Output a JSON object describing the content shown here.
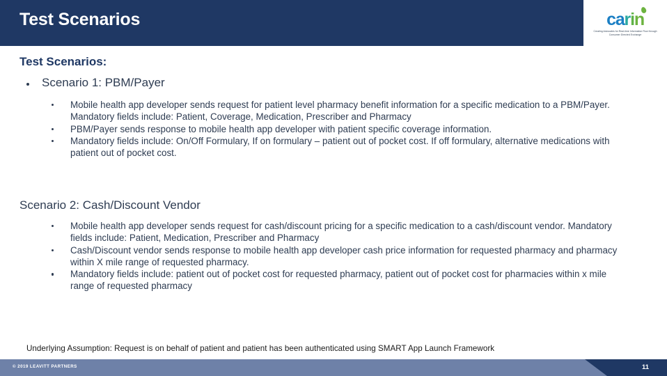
{
  "header": {
    "title": "Test Scenarios",
    "logo": {
      "wordmark": "carin",
      "letters": [
        "c",
        "a",
        "r",
        "i",
        "n"
      ],
      "tagline": "Creating Advocates for Real-time Information Flow through Consumer Directed Exchange",
      "colors": {
        "blue": "#1b7fc4",
        "teal": "#2aa9a0",
        "green": "#6cb33f"
      }
    },
    "background_color": "#1f3864"
  },
  "body": {
    "lead_label": "Test Scenarios:",
    "scenario1": {
      "heading": "Scenario 1: PBM/Payer",
      "bullets": [
        "Mobile health app developer sends request for patient level pharmacy benefit information for a specific medication to a PBM/Payer.  Mandatory fields include: Patient, Coverage, Medication, Prescriber and Pharmacy",
        "PBM/Payer sends response to mobile health app developer with patient specific coverage information.",
        "Mandatory fields include: On/Off Formulary, If on formulary – patient out of pocket cost.  If off formulary, alternative medications with patient out of pocket cost."
      ]
    },
    "scenario2": {
      "heading": "Scenario 2: Cash/Discount Vendor",
      "bullets": [
        "Mobile health app developer sends request for cash/discount pricing for a specific medication to a cash/discount vendor.  Mandatory fields include: Patient, Medication, Prescriber and Pharmacy",
        "Cash/Discount vendor sends response to mobile health app developer cash price information for requested pharmacy and pharmacy within X mile range of requested pharmacy.",
        "Mandatory fields include: patient out of pocket cost for requested pharmacy, patient out of pocket cost for pharmacies within x mile range of requested pharmacy"
      ]
    },
    "assumption": "Underlying Assumption: Request is on behalf of patient and patient has been authenticated using SMART App Launch Framework"
  },
  "footer": {
    "copyright": "© 2019 LEAVITT PARTNERS",
    "page_number": "11",
    "bar_color": "#6e81a8",
    "corner_color": "#1f3864"
  }
}
